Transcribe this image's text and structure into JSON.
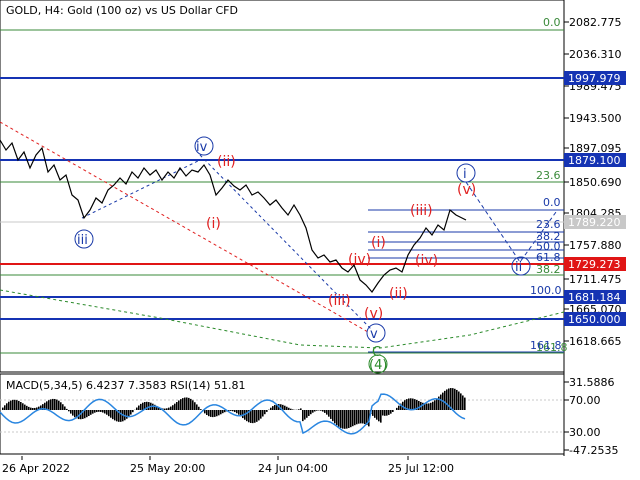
{
  "header": {
    "title": "GOLD, H4:  Gold (100 oz) vs US Dollar CFD"
  },
  "indicator": {
    "label": "MACD(5,34,5) 6.4237 7.3583 RSI(14) 51.81"
  },
  "price_axis": {
    "ticks": [
      "2082.775",
      "2036.310",
      "1989.475",
      "1943.500",
      "1897.095",
      "1850.690",
      "1804.285",
      "1757.880",
      "1711.475",
      "1665.070",
      "1618.665"
    ],
    "tags": [
      {
        "text": "1997.979",
        "color": "#1533b3"
      },
      {
        "text": "1879.100",
        "color": "#1533b3"
      },
      {
        "text": "1789.220",
        "color": "#c8c8c8"
      },
      {
        "text": "1729.273",
        "color": "#e01515"
      },
      {
        "text": "1681.184",
        "color": "#1533b3"
      },
      {
        "text": "1650.000",
        "color": "#1533b3"
      }
    ]
  },
  "indicator_axis": {
    "ticks": [
      "31.5886",
      "70.00",
      "30.00",
      "-47.2535"
    ]
  },
  "time_axis": {
    "ticks": [
      "26 Apr 2022",
      "25 May 20:00",
      "24 Jun 04:00",
      "25 Jul 12:00"
    ]
  },
  "fib_levels": {
    "green": [
      "0.0",
      "23.6",
      "38.2",
      "100.0",
      "161.8"
    ],
    "blue": [
      "0.0",
      "23.6",
      "38.2",
      "50.0",
      "61.8",
      "100.0",
      "161.8"
    ]
  },
  "waves": {
    "red": [
      "(ii)",
      "(i)",
      "(iii)",
      "(iv)",
      "(v)",
      "(i)",
      "(ii)",
      "(iii)",
      "(iv)",
      "(v)"
    ],
    "blue": [
      "iv",
      "iii",
      "v",
      "i",
      "ii"
    ],
    "green": [
      "C",
      "(4)"
    ]
  },
  "colors": {
    "price_line": "#000000",
    "macd": "#000000",
    "rsi": "#2a86e0"
  }
}
